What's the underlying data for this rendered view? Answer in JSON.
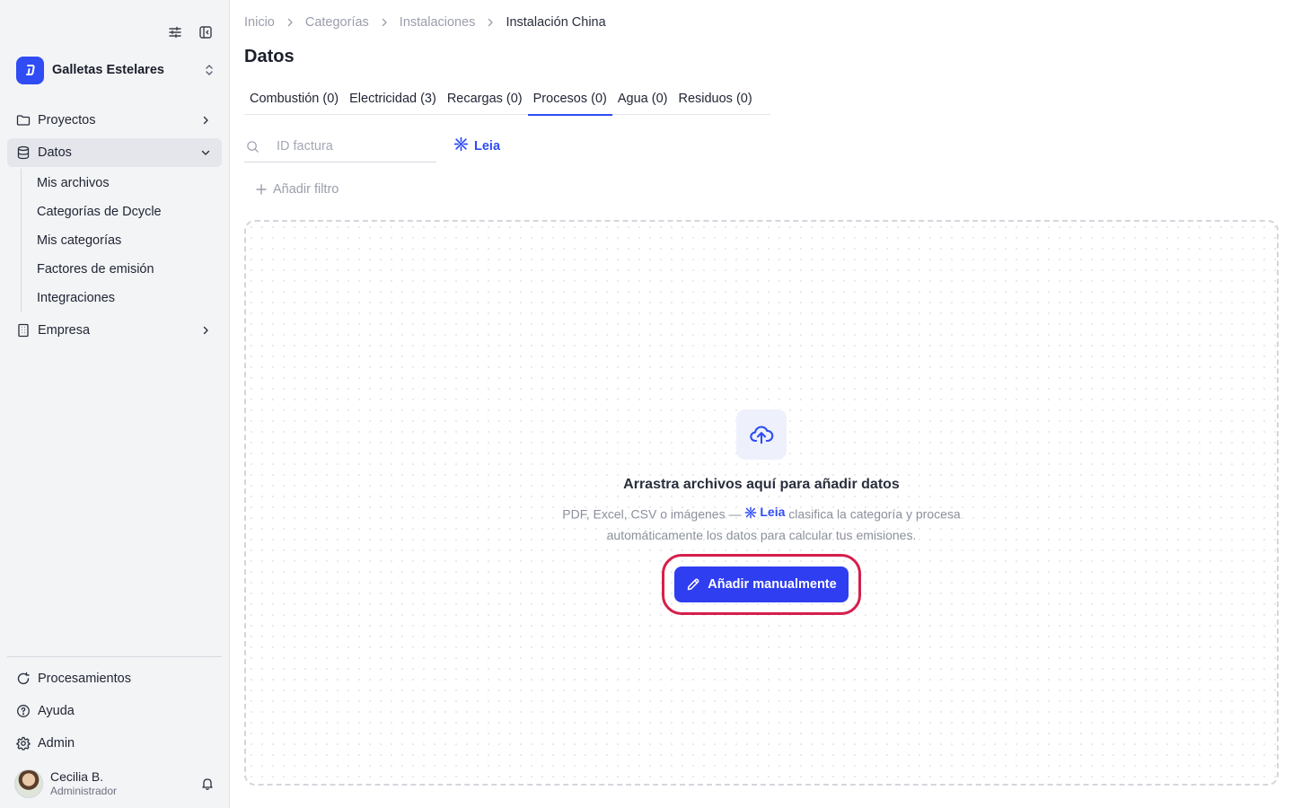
{
  "sidebar": {
    "org_name": "Galletas Estelares",
    "nav": [
      {
        "label": "Proyectos",
        "icon": "folder-icon"
      },
      {
        "label": "Datos",
        "icon": "database-icon"
      },
      {
        "label": "Empresa",
        "icon": "building-icon"
      }
    ],
    "datos_sub": [
      "Mis archivos",
      "Categorías de Dcycle",
      "Mis categorías",
      "Factores de emisión",
      "Integraciones"
    ],
    "bottom": [
      {
        "label": "Procesamientos",
        "icon": "refresh-icon"
      },
      {
        "label": "Ayuda",
        "icon": "help-icon"
      },
      {
        "label": "Admin",
        "icon": "gear-icon"
      }
    ],
    "user": {
      "name": "Cecilia B.",
      "role": "Administrador"
    }
  },
  "breadcrumb": [
    "Inicio",
    "Categorías",
    "Instalaciones",
    "Instalación China"
  ],
  "page_title": "Datos",
  "tabs": [
    {
      "label": "Combustión (0)"
    },
    {
      "label": "Electricidad (3)"
    },
    {
      "label": "Recargas (0)"
    },
    {
      "label": "Procesos (0)",
      "active": true
    },
    {
      "label": "Agua (0)"
    },
    {
      "label": "Residuos (0)"
    }
  ],
  "search": {
    "placeholder": "ID factura",
    "value": ""
  },
  "leia_label": "Leia",
  "add_filter_label": "Añadir filtro",
  "dropzone": {
    "title": "Arrastra archivos aquí para añadir datos",
    "desc_before": "PDF, Excel, CSV o imágenes —",
    "desc_leia": "Leia",
    "desc_after": "clasifica la categoría y procesa automáticamente los datos para calcular tus emisiones.",
    "button_label": "Añadir manualmente"
  },
  "colors": {
    "accent": "#2f4cf5",
    "highlight": "#d61f4b",
    "sidebar_bg": "#f3f4f6"
  }
}
